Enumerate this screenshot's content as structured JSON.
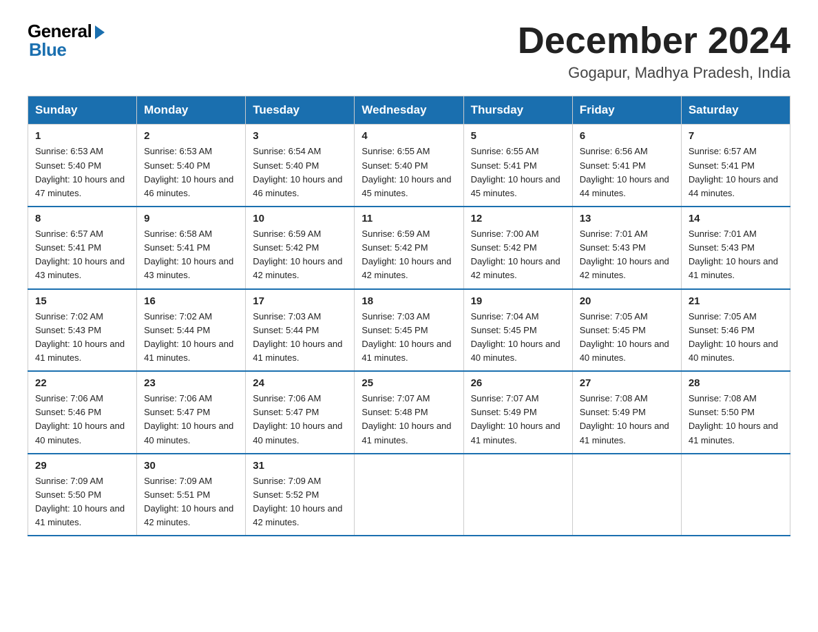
{
  "header": {
    "logo_general": "General",
    "logo_blue": "Blue",
    "month_title": "December 2024",
    "location": "Gogapur, Madhya Pradesh, India"
  },
  "columns": [
    "Sunday",
    "Monday",
    "Tuesday",
    "Wednesday",
    "Thursday",
    "Friday",
    "Saturday"
  ],
  "weeks": [
    [
      {
        "day": "1",
        "sunrise": "6:53 AM",
        "sunset": "5:40 PM",
        "daylight": "10 hours and 47 minutes."
      },
      {
        "day": "2",
        "sunrise": "6:53 AM",
        "sunset": "5:40 PM",
        "daylight": "10 hours and 46 minutes."
      },
      {
        "day": "3",
        "sunrise": "6:54 AM",
        "sunset": "5:40 PM",
        "daylight": "10 hours and 46 minutes."
      },
      {
        "day": "4",
        "sunrise": "6:55 AM",
        "sunset": "5:40 PM",
        "daylight": "10 hours and 45 minutes."
      },
      {
        "day": "5",
        "sunrise": "6:55 AM",
        "sunset": "5:41 PM",
        "daylight": "10 hours and 45 minutes."
      },
      {
        "day": "6",
        "sunrise": "6:56 AM",
        "sunset": "5:41 PM",
        "daylight": "10 hours and 44 minutes."
      },
      {
        "day": "7",
        "sunrise": "6:57 AM",
        "sunset": "5:41 PM",
        "daylight": "10 hours and 44 minutes."
      }
    ],
    [
      {
        "day": "8",
        "sunrise": "6:57 AM",
        "sunset": "5:41 PM",
        "daylight": "10 hours and 43 minutes."
      },
      {
        "day": "9",
        "sunrise": "6:58 AM",
        "sunset": "5:41 PM",
        "daylight": "10 hours and 43 minutes."
      },
      {
        "day": "10",
        "sunrise": "6:59 AM",
        "sunset": "5:42 PM",
        "daylight": "10 hours and 42 minutes."
      },
      {
        "day": "11",
        "sunrise": "6:59 AM",
        "sunset": "5:42 PM",
        "daylight": "10 hours and 42 minutes."
      },
      {
        "day": "12",
        "sunrise": "7:00 AM",
        "sunset": "5:42 PM",
        "daylight": "10 hours and 42 minutes."
      },
      {
        "day": "13",
        "sunrise": "7:01 AM",
        "sunset": "5:43 PM",
        "daylight": "10 hours and 42 minutes."
      },
      {
        "day": "14",
        "sunrise": "7:01 AM",
        "sunset": "5:43 PM",
        "daylight": "10 hours and 41 minutes."
      }
    ],
    [
      {
        "day": "15",
        "sunrise": "7:02 AM",
        "sunset": "5:43 PM",
        "daylight": "10 hours and 41 minutes."
      },
      {
        "day": "16",
        "sunrise": "7:02 AM",
        "sunset": "5:44 PM",
        "daylight": "10 hours and 41 minutes."
      },
      {
        "day": "17",
        "sunrise": "7:03 AM",
        "sunset": "5:44 PM",
        "daylight": "10 hours and 41 minutes."
      },
      {
        "day": "18",
        "sunrise": "7:03 AM",
        "sunset": "5:45 PM",
        "daylight": "10 hours and 41 minutes."
      },
      {
        "day": "19",
        "sunrise": "7:04 AM",
        "sunset": "5:45 PM",
        "daylight": "10 hours and 40 minutes."
      },
      {
        "day": "20",
        "sunrise": "7:05 AM",
        "sunset": "5:45 PM",
        "daylight": "10 hours and 40 minutes."
      },
      {
        "day": "21",
        "sunrise": "7:05 AM",
        "sunset": "5:46 PM",
        "daylight": "10 hours and 40 minutes."
      }
    ],
    [
      {
        "day": "22",
        "sunrise": "7:06 AM",
        "sunset": "5:46 PM",
        "daylight": "10 hours and 40 minutes."
      },
      {
        "day": "23",
        "sunrise": "7:06 AM",
        "sunset": "5:47 PM",
        "daylight": "10 hours and 40 minutes."
      },
      {
        "day": "24",
        "sunrise": "7:06 AM",
        "sunset": "5:47 PM",
        "daylight": "10 hours and 40 minutes."
      },
      {
        "day": "25",
        "sunrise": "7:07 AM",
        "sunset": "5:48 PM",
        "daylight": "10 hours and 41 minutes."
      },
      {
        "day": "26",
        "sunrise": "7:07 AM",
        "sunset": "5:49 PM",
        "daylight": "10 hours and 41 minutes."
      },
      {
        "day": "27",
        "sunrise": "7:08 AM",
        "sunset": "5:49 PM",
        "daylight": "10 hours and 41 minutes."
      },
      {
        "day": "28",
        "sunrise": "7:08 AM",
        "sunset": "5:50 PM",
        "daylight": "10 hours and 41 minutes."
      }
    ],
    [
      {
        "day": "29",
        "sunrise": "7:09 AM",
        "sunset": "5:50 PM",
        "daylight": "10 hours and 41 minutes."
      },
      {
        "day": "30",
        "sunrise": "7:09 AM",
        "sunset": "5:51 PM",
        "daylight": "10 hours and 42 minutes."
      },
      {
        "day": "31",
        "sunrise": "7:09 AM",
        "sunset": "5:52 PM",
        "daylight": "10 hours and 42 minutes."
      },
      null,
      null,
      null,
      null
    ]
  ]
}
